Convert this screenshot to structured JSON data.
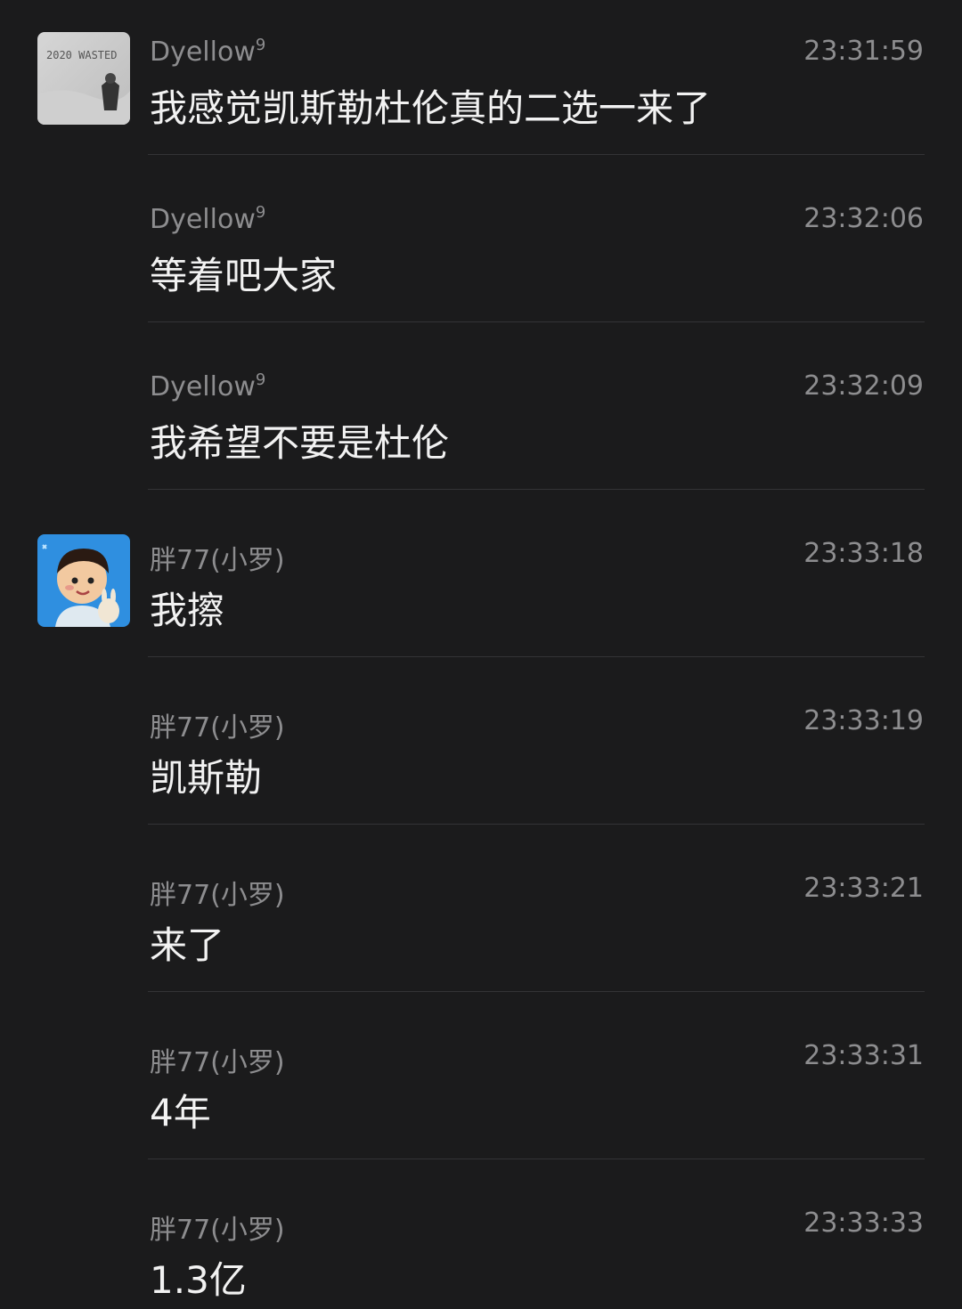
{
  "messages": [
    {
      "sender": "Dyellow",
      "sender_sup": "9",
      "time": "23:31:59",
      "text": "我感觉凯斯勒杜伦真的二选一来了",
      "avatar": "dyellow-avatar",
      "avatar_text": "2020 WASTED"
    },
    {
      "sender": "Dyellow",
      "sender_sup": "9",
      "time": "23:32:06",
      "text": "等着吧大家"
    },
    {
      "sender": "Dyellow",
      "sender_sup": "9",
      "time": "23:32:09",
      "text": "我希望不要是杜伦"
    },
    {
      "sender": "胖77(小罗)",
      "time": "23:33:18",
      "text": "我擦",
      "avatar": "cartoon-boy-avatar"
    },
    {
      "sender": "胖77(小罗)",
      "time": "23:33:19",
      "text": "凯斯勒"
    },
    {
      "sender": "胖77(小罗)",
      "time": "23:33:21",
      "text": "来了"
    },
    {
      "sender": "胖77(小罗)",
      "time": "23:33:31",
      "text": "4年"
    },
    {
      "sender": "胖77(小罗)",
      "time": "23:33:33",
      "text": "1.3亿"
    }
  ]
}
